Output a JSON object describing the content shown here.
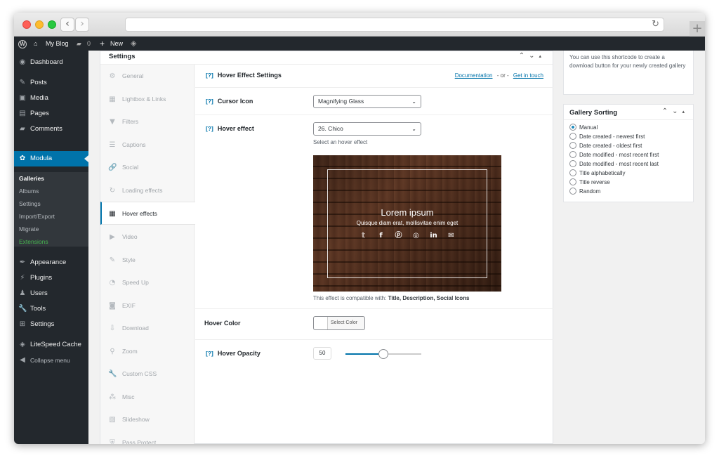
{
  "browser": {
    "back": "‹",
    "forward": "›",
    "reload": "↻",
    "new_tab": "+"
  },
  "admin_bar": {
    "wp_logo": "W",
    "home_icon": "⌂",
    "site_name": "My Blog",
    "comment_icon": "▰",
    "comments_count": "0",
    "new_icon": "+",
    "new_label": "New",
    "litespeed_icon": "◈"
  },
  "sidebar": {
    "items": [
      {
        "icon": "◉",
        "label": "Dashboard"
      },
      {
        "icon": "✎",
        "label": "Posts"
      },
      {
        "icon": "▣",
        "label": "Media"
      },
      {
        "icon": "▤",
        "label": "Pages"
      },
      {
        "icon": "▰",
        "label": "Comments"
      },
      {
        "icon": "✿",
        "label": "Modula"
      },
      {
        "icon": "✒",
        "label": "Appearance"
      },
      {
        "icon": "⚡",
        "label": "Plugins"
      },
      {
        "icon": "♟",
        "label": "Users"
      },
      {
        "icon": "🔧",
        "label": "Tools"
      },
      {
        "icon": "⊞",
        "label": "Settings"
      },
      {
        "icon": "◈",
        "label": "LiteSpeed Cache"
      },
      {
        "icon": "◀",
        "label": "Collapse menu"
      }
    ],
    "submenu": [
      "Galleries",
      "Albums",
      "Settings",
      "Import/Export",
      "Migrate",
      "Extensions"
    ]
  },
  "settings_box": {
    "title": "Settings",
    "controls": [
      "⌃",
      "⌄",
      "▴"
    ],
    "tabs": [
      {
        "icon": "⚙",
        "label": "General"
      },
      {
        "icon": "▦",
        "label": "Lightbox & Links"
      },
      {
        "icon": "▼",
        "label": "Filters"
      },
      {
        "icon": "☰",
        "label": "Captions"
      },
      {
        "icon": "🔗",
        "label": "Social"
      },
      {
        "icon": "↻",
        "label": "Loading effects"
      },
      {
        "icon": "▦",
        "label": "Hover effects"
      },
      {
        "icon": "▶",
        "label": "Video"
      },
      {
        "icon": "✎",
        "label": "Style"
      },
      {
        "icon": "◔",
        "label": "Speed Up"
      },
      {
        "icon": "◙",
        "label": "EXIF"
      },
      {
        "icon": "⇩",
        "label": "Download"
      },
      {
        "icon": "⚲",
        "label": "Zoom"
      },
      {
        "icon": "🔧",
        "label": "Custom CSS"
      },
      {
        "icon": "⁂",
        "label": "Misc"
      },
      {
        "icon": "▧",
        "label": "Slideshow"
      },
      {
        "icon": "⛨",
        "label": "Pass Protect"
      }
    ]
  },
  "hover_panel": {
    "help": "[?]",
    "heading": "Hover Effect Settings",
    "documentation_link": "Documentation",
    "or_text": "- or -",
    "get_in_touch_link": "Get in touch",
    "cursor_icon_label": "Cursor Icon",
    "cursor_icon_value": "Magnifying Glass",
    "hover_effect_label": "Hover effect",
    "hover_effect_value": "26. Chico",
    "hover_effect_desc": "Select an hover effect",
    "preview_title": "Lorem ipsum",
    "preview_subtitle": "Quisque diam erat, mollisvitae enim eget",
    "social_icons": [
      "𝕥",
      "f",
      "ⓟ",
      "◎",
      "in",
      "✉"
    ],
    "compat_prefix": "This effect is compatible with:",
    "compat_items": "Title, Description, Social Icons",
    "hover_color_label": "Hover Color",
    "select_color_button": "Select Color",
    "hover_opacity_label": "Hover Opacity",
    "hover_opacity_value": "50",
    "caret": "⌄"
  },
  "side": {
    "shortcode_text": "You can use this shortcode to create a download button for your newly created gallery",
    "sorting_title": "Gallery Sorting",
    "sorting_controls": [
      "⌃",
      "⌄",
      "▴"
    ],
    "sorting_options": [
      "Manual",
      "Date created - newest first",
      "Date created - oldest first",
      "Date modified - most recent first",
      "Date modified - most recent last",
      "Title alphabetically",
      "Title reverse",
      "Random"
    ],
    "selected_option": "Manual"
  },
  "colors": {
    "accent": "#0073aa",
    "admin_dark": "#23282d",
    "extensions_green": "#46b450"
  }
}
